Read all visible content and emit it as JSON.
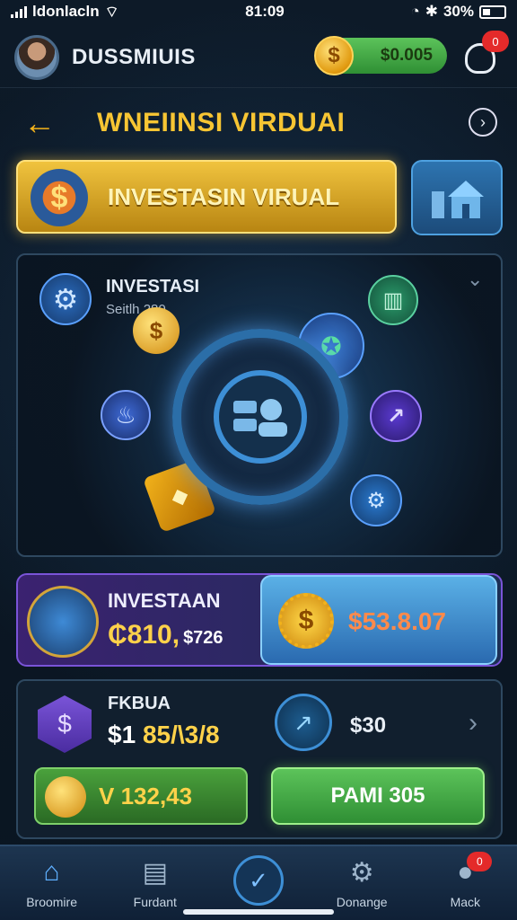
{
  "status_bar": {
    "carrier": "ldonlacln",
    "time": "81:09",
    "battery": "30%"
  },
  "header": {
    "username": "DUSSMIUIS",
    "coin_balance": "$0.005",
    "coin_symbol": "$",
    "notification_count": "0"
  },
  "title_bar": {
    "title": "WNEIINSI VIRDUAI"
  },
  "banner": {
    "label": "INVESTASIN VIRUAL",
    "symbol": "$"
  },
  "panel": {
    "title": "INVESTASI",
    "subtitle": "Seitlh 280"
  },
  "invest_row": {
    "title": "INVESTAAN",
    "value": "₵810,",
    "value_small": "$726",
    "amount_button": "$53.8.07",
    "amount_symbol": "$"
  },
  "fkbua": {
    "title": "FKBUA",
    "value_prefix": "$1",
    "value_highlight": "85/\\3/8",
    "amount": "$30",
    "left_button": "V 132,43",
    "right_button": "PAMI 305"
  },
  "bottom_nav": {
    "items": [
      {
        "label": "Broomire",
        "icon": "home-icon"
      },
      {
        "label": "Furdant",
        "icon": "building-icon"
      },
      {
        "label": "",
        "icon": "check-icon"
      },
      {
        "label": "Donange",
        "icon": "gear-icon"
      },
      {
        "label": "Mack",
        "icon": "user-icon",
        "badge": "0"
      }
    ]
  },
  "colors": {
    "gold": "#f7c533",
    "green": "#5cc35a",
    "purple": "#7a54d8",
    "blue": "#3d8fd6"
  }
}
